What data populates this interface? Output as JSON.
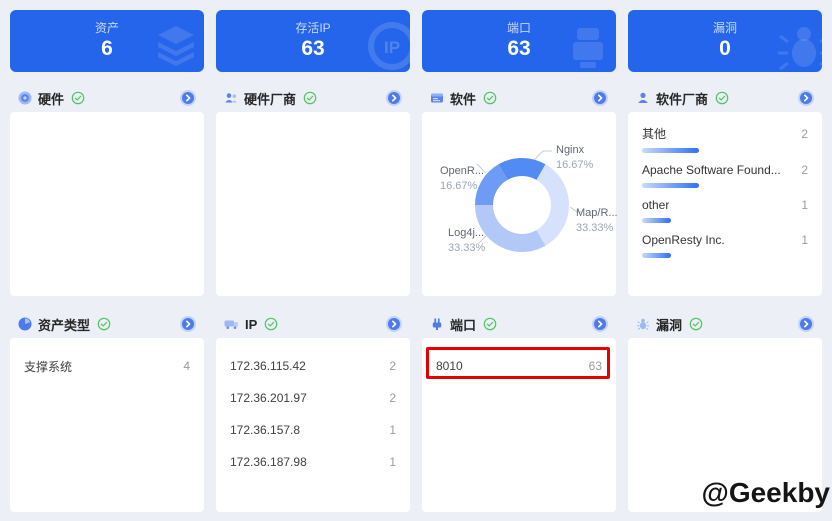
{
  "watermark": "@Geekby",
  "colors": {
    "card_blue": "#2565EB",
    "accent_blue": "#2F6FF2",
    "check_green": "#4FC464",
    "highlight_red": "#E60000",
    "page_bg": "#ECEFF6"
  },
  "stat_cards": [
    {
      "label": "资产",
      "value": "6",
      "icon": "layers-icon"
    },
    {
      "label": "存活IP",
      "value": "63",
      "icon": "ip-badge-icon",
      "icon_text": "IP"
    },
    {
      "label": "端口",
      "value": "63",
      "icon": "port-device-icon"
    },
    {
      "label": "漏洞",
      "value": "0",
      "icon": "bug-icon"
    }
  ],
  "panels": {
    "hardware": {
      "title": "硬件",
      "items": []
    },
    "hardware_vendor": {
      "title": "硬件厂商",
      "items": []
    },
    "software": {
      "title": "软件"
    },
    "software_vendor": {
      "title": "软件厂商"
    },
    "asset_type": {
      "title": "资产类型",
      "items": [
        {
          "label": "支撑系统",
          "value": "4"
        }
      ]
    },
    "ip": {
      "title": "IP",
      "items": [
        {
          "label": "172.36.115.42",
          "value": "2"
        },
        {
          "label": "172.36.201.97",
          "value": "2"
        },
        {
          "label": "172.36.157.8",
          "value": "1"
        },
        {
          "label": "172.36.187.98",
          "value": "1"
        }
      ]
    },
    "port": {
      "title": "端口",
      "items": [
        {
          "label": "8010",
          "value": "63",
          "highlighted": true
        }
      ]
    },
    "vulnerability": {
      "title": "漏洞",
      "items": []
    }
  },
  "chart_data": [
    {
      "type": "pie",
      "title": "软件",
      "donut": true,
      "labels": [
        "Nginx",
        "Map/R...",
        "Log4j...",
        "OpenR..."
      ],
      "values": [
        16.67,
        33.33,
        33.33,
        16.67
      ],
      "percent_labels": [
        "16.67%",
        "33.33%",
        "33.33%",
        "16.67%"
      ],
      "colors": [
        "#538BF4",
        "#D6E1FC",
        "#B2C9F8",
        "#6E9BF4"
      ],
      "start_angle_deg_cw_from_top": -30,
      "legend_position": "none"
    },
    {
      "type": "bar",
      "title": "软件厂商",
      "orientation": "horizontal",
      "categories": [
        "其他",
        "Apache Software Found...",
        "other",
        "OpenResty Inc."
      ],
      "values": [
        2,
        2,
        1,
        1
      ],
      "max": 2
    }
  ]
}
